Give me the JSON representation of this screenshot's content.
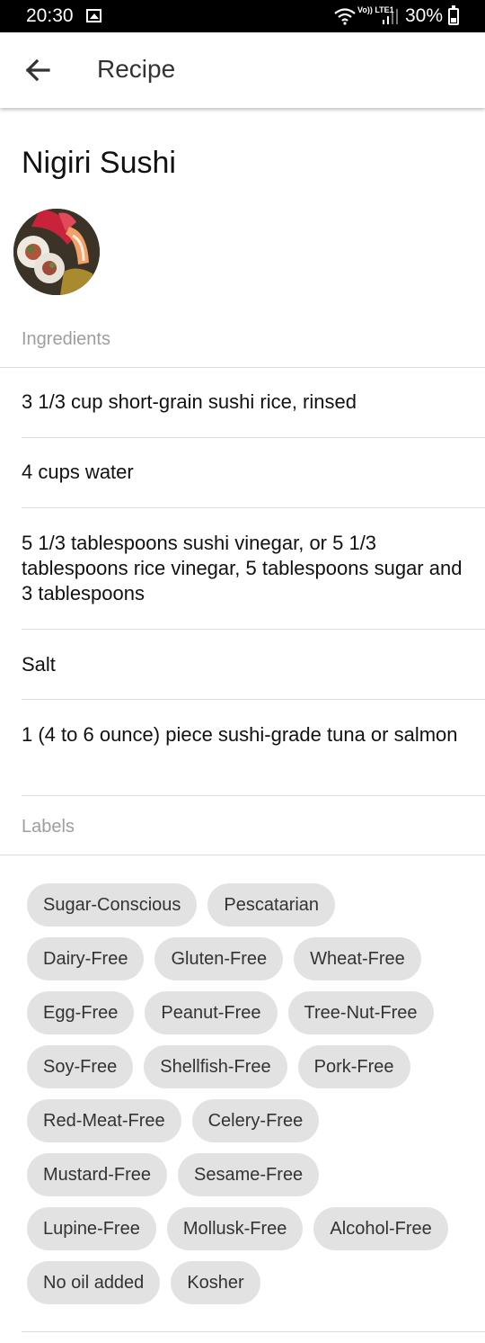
{
  "status_bar": {
    "time": "20:30",
    "lte_label": "Vo)) LTE1",
    "battery": "30%"
  },
  "app_bar": {
    "title": "Recipe"
  },
  "recipe": {
    "name": "Nigiri Sushi",
    "ingredients_label": "Ingredients",
    "ingredients": [
      "3 1/3 cup short-grain sushi rice, rinsed",
      "4 cups water",
      "5 1/3 tablespoons sushi vinegar, or 5 1/3 tablespoons rice vinegar, 5 tablespoons sugar and 3 tablespoons",
      "Salt",
      "1 (4 to 6 ounce) piece sushi-grade tuna or salmon"
    ],
    "labels_label": "Labels",
    "label_rows": [
      [
        "Sugar-Conscious",
        "Pescatarian"
      ],
      [
        "Dairy-Free",
        "Gluten-Free",
        "Wheat-Free"
      ],
      [
        "Egg-Free",
        "Peanut-Free",
        "Tree-Nut-Free"
      ],
      [
        "Soy-Free",
        "Shellfish-Free",
        "Pork-Free"
      ],
      [
        "Red-Meat-Free",
        "Celery-Free"
      ],
      [
        "Mustard-Free",
        "Sesame-Free"
      ],
      [
        "Lupine-Free",
        "Mollusk-Free",
        "Alcohol-Free"
      ],
      [
        "No oil added",
        "Kosher"
      ]
    ]
  },
  "colors": {
    "chip_bg": "#e2e2e2",
    "section_label": "#9e9e9e",
    "divider": "#dcdcdc"
  }
}
